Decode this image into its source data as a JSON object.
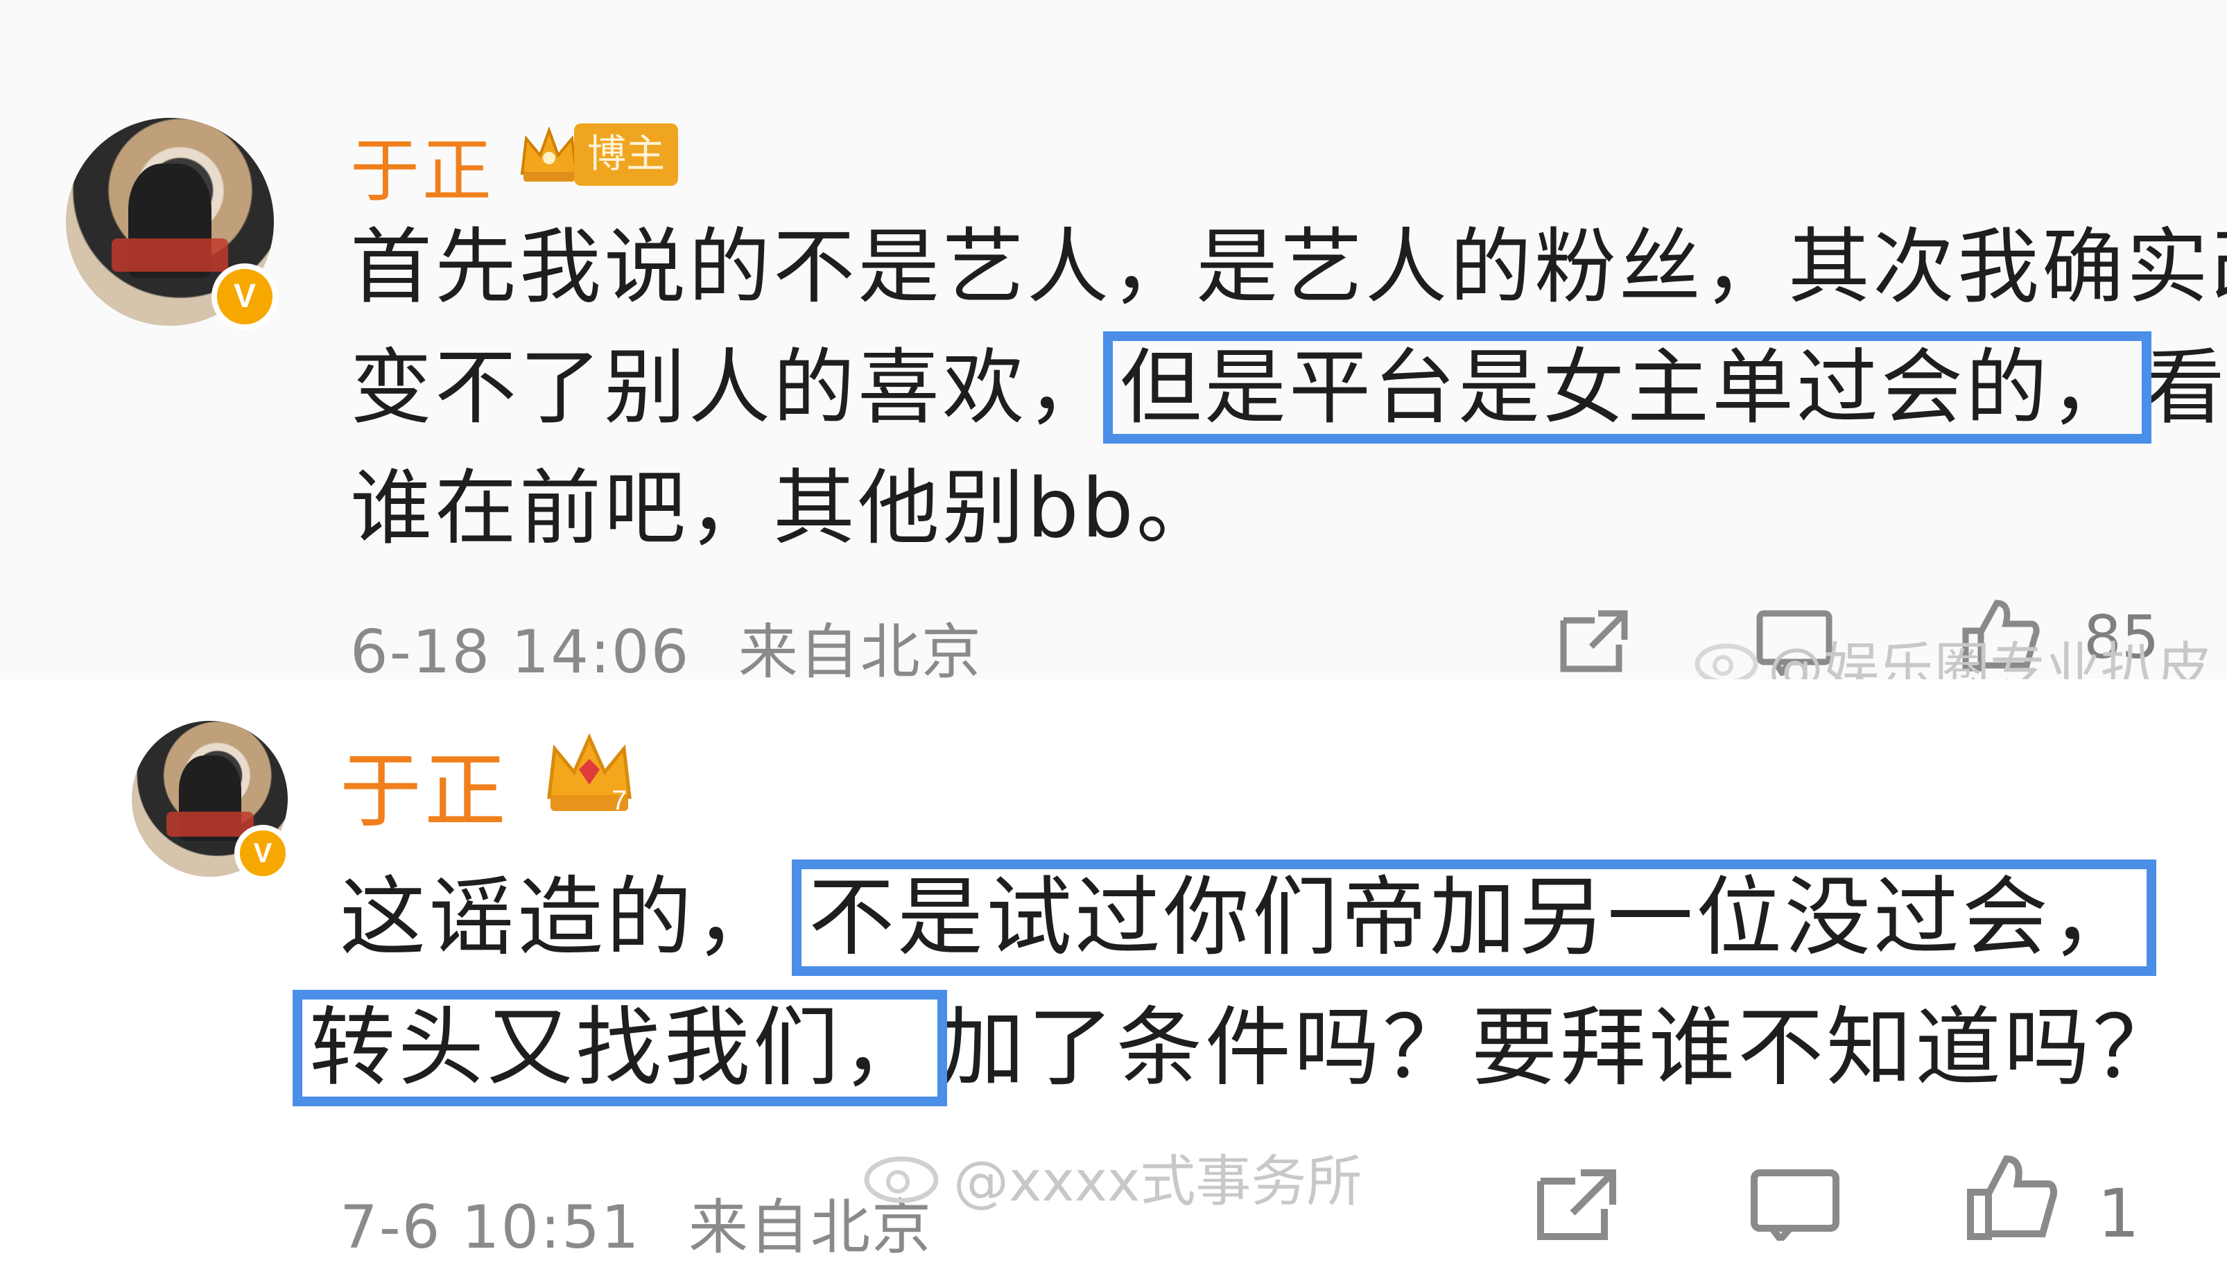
{
  "comments": [
    {
      "username": "于正",
      "badge_label": "博主",
      "verified_mark": "V",
      "line1": "首先我说的不是艺人，是艺人的粉丝，其次我确实改",
      "line2_pre": "变不了别人的喜欢，",
      "line2_hl": "但是平台是女主单过会的，",
      "line2_post": "看看",
      "line3": "谁在前吧，其他别bb。",
      "timestamp": "6-18 14:06",
      "source": "来自北京",
      "like_count": "85",
      "watermark": "@娱乐圈专业扒皮"
    },
    {
      "username": "于正",
      "verified_mark": "V",
      "line1_pre": "这谣造的，",
      "line1_hl": "不是试过你们帝加另一位没过会，",
      "line2_hl": "转头又找我们，",
      "line2_post": "加了条件吗？要拜谁不知道吗？",
      "timestamp": "7-6 10:51",
      "source": "来自北京",
      "like_count": "1",
      "watermark": "@xxxx式事务所"
    }
  ],
  "icons": {
    "share": "share-icon",
    "comment": "comment-icon",
    "like": "thumbs-up-icon",
    "crown": "crown-icon",
    "weibo": "weibo-logo-icon"
  },
  "colors": {
    "username": "#f07f1c",
    "highlight_box": "#4a8ee8",
    "verified": "#f7a800"
  }
}
